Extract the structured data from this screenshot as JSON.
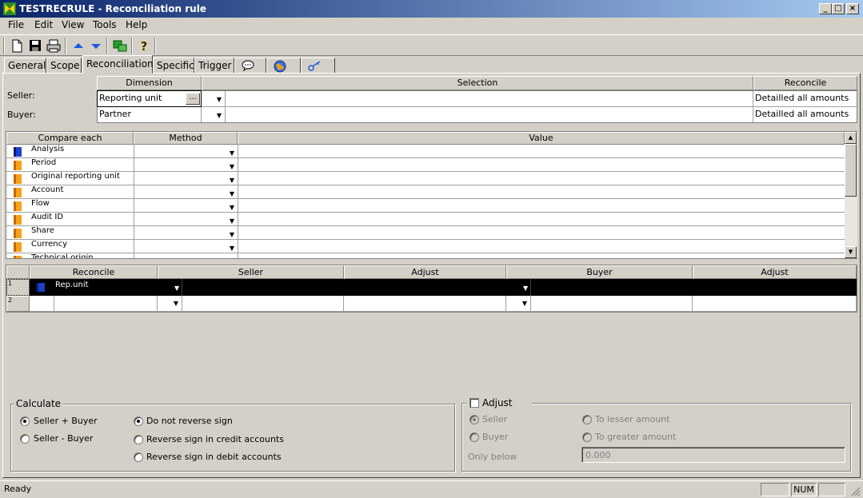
{
  "window": {
    "title": "TESTRECRULE - Reconciliation rule",
    "min": "_",
    "max": "□",
    "close": "×"
  },
  "menu": [
    "File",
    "Edit",
    "View",
    "Tools",
    "Help"
  ],
  "toolbar": [
    "new-icon",
    "save-icon",
    "print-icon",
    "up-arrow-icon",
    "down-arrow-icon",
    "refresh-icon",
    "help-icon"
  ],
  "tabs": [
    "General",
    "Scope",
    "Reconciliation",
    "Specific",
    "Trigger"
  ],
  "dimension_grid": {
    "headers": {
      "dimension": "Dimension",
      "selection": "Selection",
      "reconcile": "Reconcile"
    },
    "seller": {
      "label": "Seller:",
      "dimension": "Reporting unit",
      "browse": "...",
      "reconcile": "Detailled all amounts"
    },
    "buyer": {
      "label": "Buyer:",
      "dimension": "Partner",
      "reconcile": "Detailled all amounts"
    }
  },
  "compare_grid": {
    "headers": {
      "compare": "Compare each",
      "method": "Method",
      "value": "Value"
    },
    "rows": [
      "Analysis",
      "Period",
      "Original reporting unit",
      "Account",
      "Flow",
      "Audit ID",
      "Share",
      "Currency",
      "Technical origin"
    ]
  },
  "reconcile_grid": {
    "headers": {
      "reconcile": "Reconcile",
      "seller": "Seller",
      "adjust1": "Adjust",
      "buyer": "Buyer",
      "adjust2": "Adjust"
    },
    "rows": [
      {
        "num": "1",
        "reconcile": "Rep.unit"
      },
      {
        "num": "2",
        "reconcile": ""
      }
    ]
  },
  "calculate": {
    "legend": "Calculate",
    "options": [
      "Seller + Buyer",
      "Seller - Buyer"
    ],
    "sign_options": [
      "Do not reverse sign",
      "Reverse sign in credit accounts",
      "Reverse sign in debit accounts"
    ]
  },
  "adjust": {
    "legend": "Adjust",
    "left_options": [
      "Seller",
      "Buyer"
    ],
    "right_options": [
      "To lesser amount",
      "To greater amount"
    ],
    "only_below_label": "Only below",
    "only_below_value": "0.000"
  },
  "status": {
    "text": "Ready",
    "num": "NUM"
  },
  "colors": {
    "title_start": "#0a246a",
    "title_end": "#a6caf0",
    "book_orange": "#f7a21a",
    "book_blue": "#1e40c8",
    "selected_row": "#000000"
  }
}
